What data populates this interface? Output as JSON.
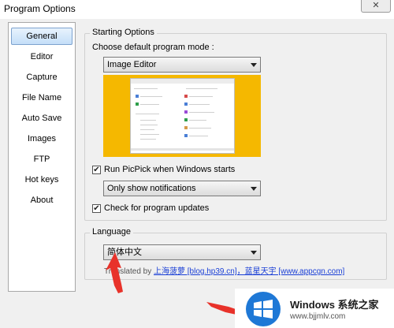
{
  "window": {
    "title": "Program Options",
    "close_glyph": "✕"
  },
  "sidebar": {
    "items": [
      {
        "label": "General",
        "selected": true
      },
      {
        "label": "Editor"
      },
      {
        "label": "Capture"
      },
      {
        "label": "File Name"
      },
      {
        "label": "Auto Save"
      },
      {
        "label": "Images"
      },
      {
        "label": "FTP"
      },
      {
        "label": "Hot keys"
      },
      {
        "label": "About"
      }
    ]
  },
  "startup": {
    "group_label": "Starting Options",
    "mode_prompt": "Choose default program mode :",
    "mode_value": "Image Editor",
    "run_on_start": {
      "label": "Run PicPick when Windows starts",
      "checked": true
    },
    "notify_value": "Only show notifications",
    "check_updates": {
      "label": "Check for program updates",
      "checked": true
    }
  },
  "language": {
    "group_label": "Language",
    "value": "简体中文",
    "translated_by_prefix": "Translated by",
    "translators": "上海菠萝 [blog.hp39.cn]，蓝星天宇 [www.appcgn.com]"
  },
  "watermark": {
    "text": "Windows 系统之家",
    "url": "www.bjjmlv.com"
  },
  "colors": {
    "preview_bg": "#f5b800",
    "arrow_red": "#e8322a",
    "link": "#1a3fd6"
  }
}
